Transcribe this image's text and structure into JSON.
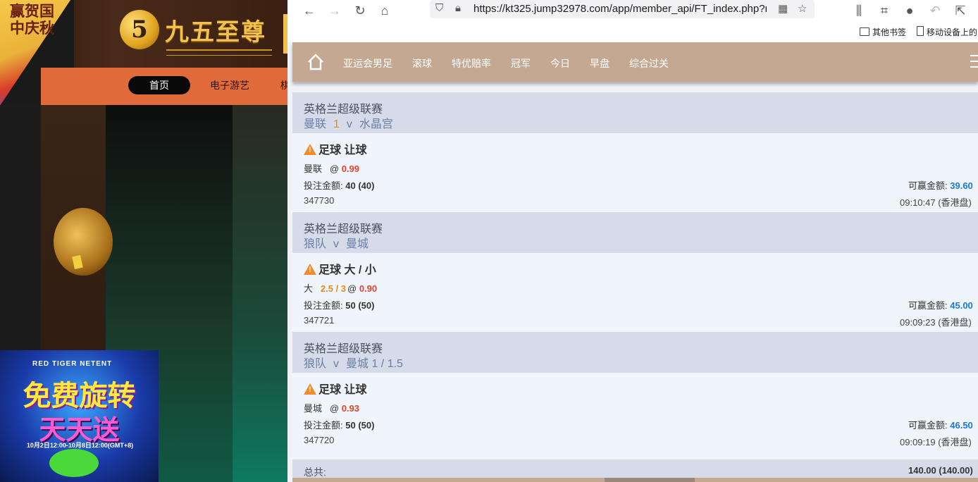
{
  "left_site": {
    "ribbon_text": "赢贺国中庆秋",
    "logo_badge": "5",
    "logo_text": "九五至尊",
    "nav": {
      "home": "首页",
      "games": "电子游艺",
      "more": "棋"
    },
    "promo": {
      "brands": "RED TIGER  NETENT",
      "title": "免费旋转",
      "subtitle": "天天送",
      "date": "10月2日12:00-10月8日12:00(GMT+8)"
    }
  },
  "browser": {
    "url": "https://kt325.jump32978.com/app/member_api/FT_index.php?m",
    "bookmarks": {
      "other": "其他书签",
      "mobile": "移动设备上的"
    }
  },
  "app_nav": {
    "items": [
      "亚运会男足",
      "滚球",
      "特优赔率",
      "冠军",
      "今日",
      "早盘",
      "综合过关"
    ]
  },
  "bets": [
    {
      "league": "英格兰超级联赛",
      "home": "曼联",
      "score": "1",
      "vs": "v",
      "away": "水晶宫",
      "type": "足球 让球",
      "selection": "曼联",
      "line": "",
      "at": "@",
      "odds": "0.99",
      "stake_label": "投注金额:",
      "stake": "40 (40)",
      "win_label": "可赢金额:",
      "win": "39.60",
      "ticket": "347730",
      "time": "09:10:47 (香港盘)"
    },
    {
      "league": "英格兰超级联赛",
      "home": "狼队",
      "score": "",
      "vs": "v",
      "away": "曼城",
      "type": "足球 大 / 小",
      "selection": "大",
      "line": "2.5 / 3",
      "at": "@",
      "odds": "0.90",
      "stake_label": "投注金额:",
      "stake": "50 (50)",
      "win_label": "可赢金额:",
      "win": "45.00",
      "ticket": "347721",
      "time": "09:09:23 (香港盘)"
    },
    {
      "league": "英格兰超级联赛",
      "home": "狼队",
      "score": "",
      "vs": "v",
      "away": "曼城 1 / 1.5",
      "type": "足球 让球",
      "selection": "曼城",
      "line": "",
      "at": "@",
      "odds": "0.93",
      "stake_label": "投注金额:",
      "stake": "50 (50)",
      "win_label": "可赢金额:",
      "win": "46.50",
      "ticket": "347720",
      "time": "09:09:19 (香港盘)"
    }
  ],
  "total": {
    "label": "总共:",
    "value": "140.00 (140.00)"
  }
}
